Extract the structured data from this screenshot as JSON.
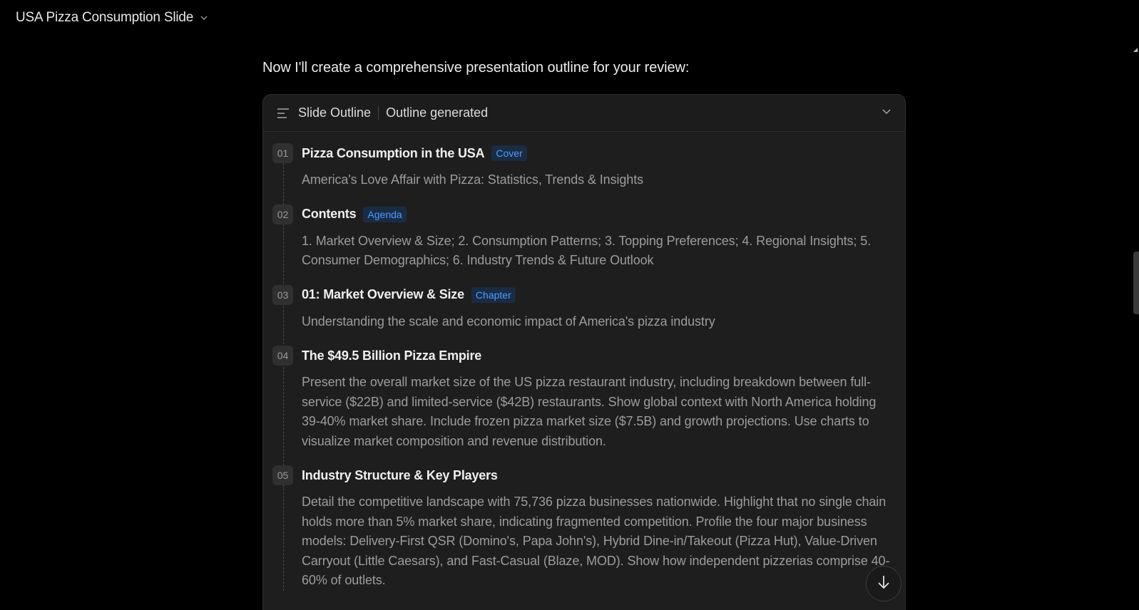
{
  "header": {
    "title": "USA Pizza Consumption Slide"
  },
  "chat": {
    "intro": "Now I'll create a comprehensive presentation outline for your review:"
  },
  "outline_card": {
    "title": "Slide Outline",
    "status": "Outline generated",
    "items": [
      {
        "num": "01",
        "title": "Pizza Consumption in the USA",
        "tag": "Cover",
        "desc": "America's Love Affair with Pizza: Statistics, Trends & Insights"
      },
      {
        "num": "02",
        "title": "Contents",
        "tag": "Agenda",
        "desc": "1. Market Overview & Size; 2. Consumption Patterns; 3. Topping Preferences; 4. Regional Insights; 5. Consumer Demographics; 6. Industry Trends & Future Outlook"
      },
      {
        "num": "03",
        "title": "01: Market Overview & Size",
        "tag": "Chapter",
        "desc": "Understanding the scale and economic impact of America's pizza industry"
      },
      {
        "num": "04",
        "title": "The $49.5 Billion Pizza Empire",
        "tag": "",
        "desc": "Present the overall market size of the US pizza restaurant industry, including breakdown between full-service ($22B) and limited-service ($42B) restaurants. Show global context with North America holding 39-40% market share. Include frozen pizza market size ($7.5B) and growth projections. Use charts to visualize market composition and revenue distribution."
      },
      {
        "num": "05",
        "title": "Industry Structure & Key Players",
        "tag": "",
        "desc": "Detail the competitive landscape with 75,736 pizza businesses nationwide. Highlight that no single chain holds more than 5% market share, indicating fragmented competition. Profile the four major business models: Delivery-First QSR (Domino's, Papa John's), Hybrid Dine-in/Takeout (Pizza Hut), Value-Driven Carryout (Little Caesars), and Fast-Casual (Blaze, MOD). Show how independent pizzerias comprise 40-60% of outlets."
      }
    ]
  },
  "icons": {
    "title_dropdown": "chevron-down-icon",
    "outline": "list-icon",
    "collapse": "chevron-down-icon",
    "scroll_down": "arrow-down-icon",
    "scroll_up": "caret-up-icon"
  },
  "colors": {
    "background": "#000000",
    "card": "#1e1e1e",
    "tag_text": "#4c9cff",
    "tag_bg": "#1a2c44"
  }
}
